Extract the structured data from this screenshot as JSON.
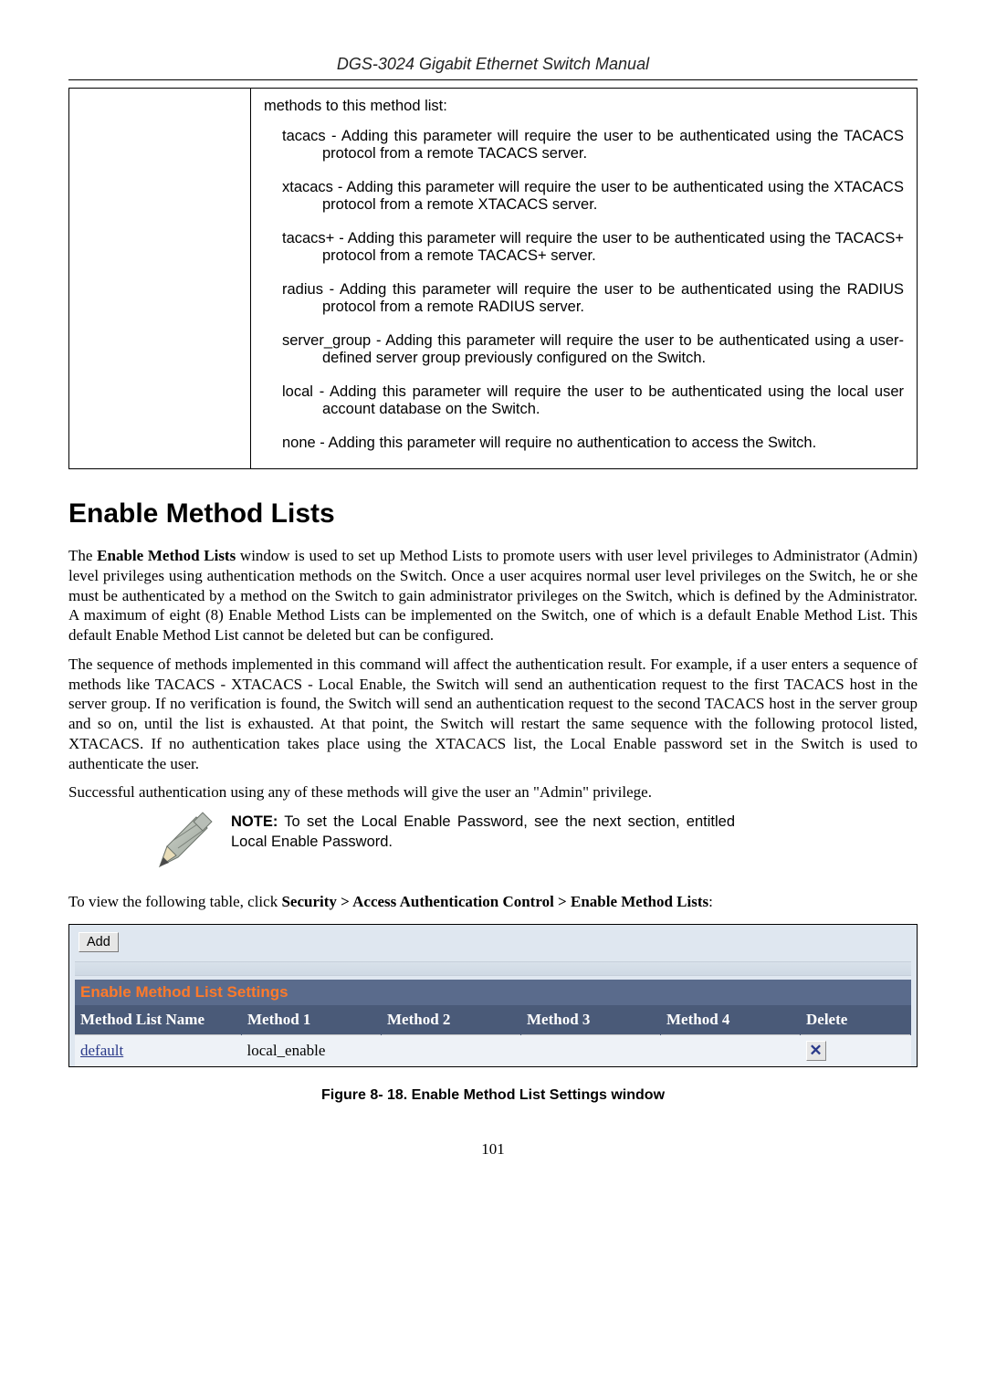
{
  "header": {
    "doc_title": "DGS-3024 Gigabit Ethernet Switch Manual"
  },
  "param_table": {
    "intro": "methods to this method list:",
    "items": [
      {
        "term": "tacacs",
        "dash": " - ",
        "desc_first": "Adding this parameter will require the user to be authenticated using the",
        "desc_rest": "TACACS protocol from a remote TACACS server."
      },
      {
        "term": "xtacacs",
        "dash": " - ",
        "desc_first": "Adding this parameter will require the user to be authenticated using the",
        "desc_rest": "XTACACS protocol from a remote XTACACS server."
      },
      {
        "term": "tacacs+",
        "dash": " - ",
        "desc_first": "Adding this parameter will require the user to be authenticated using the",
        "desc_rest": "TACACS+ protocol from a remote TACACS+ server."
      },
      {
        "term": "radius",
        "dash": " - ",
        "desc_first": "Adding this parameter will require the user to be authenticated using the",
        "desc_rest": "RADIUS protocol from a remote RADIUS server."
      },
      {
        "term": "server_group",
        "dash": " - ",
        "desc_first": "Adding this parameter will require the user to be authenticated",
        "desc_rest": "using a user-defined server group previously configured on the Switch."
      },
      {
        "term": "local",
        "dash": " - ",
        "desc_first": "Adding this parameter will require the user to be authenticated using the",
        "desc_rest": "local user account database on the Switch."
      },
      {
        "term": "none",
        "dash": " - ",
        "desc_first": "Adding this parameter will require no authentication to access the Switch.",
        "desc_rest": ""
      }
    ]
  },
  "section": {
    "heading": "Enable Method Lists",
    "p1_a": "The ",
    "p1_b": "Enable Method Lists",
    "p1_c": " window is used to set up Method Lists to promote users with user level privileges to Administrator (Admin) level privileges using authentication methods on the Switch. Once a user acquires normal user level privileges on the Switch, he or she must be authenticated by a method on the Switch to gain administrator privileges on the Switch, which is defined by the Administrator. A maximum of eight (8) Enable Method Lists can be implemented on the Switch, one of which is a default Enable Method List. This default Enable Method List cannot be deleted but can be configured.",
    "p2": "The sequence of methods implemented in this command will affect the authentication result. For example, if a user enters a sequence of methods like TACACS - XTACACS - Local Enable, the Switch will send an authentication request to the first TACACS host in the server group. If no verification is found, the Switch will send an authentication request to the second TACACS host in the server group and so on, until the list is exhausted. At that point, the Switch will restart the same sequence with the following protocol listed, XTACACS. If no authentication takes place using the XTACACS list, the Local Enable password set in the Switch is used to authenticate the user.",
    "p3": "Successful authentication using any of these methods will give the user an \"Admin\" privilege.",
    "note_label": "NOTE:",
    "note_text": " To set the Local Enable Password, see the next section, entitled Local Enable Password.",
    "nav_a": "To view the following table, click ",
    "nav_b": "Security > Access Authentication Control > Enable Method Lists",
    "nav_c": ":"
  },
  "ui": {
    "add_label": "Add",
    "title": "Enable Method List Settings",
    "cols": {
      "c0": "Method List Name",
      "c1": "Method 1",
      "c2": "Method 2",
      "c3": "Method 3",
      "c4": "Method 4",
      "c5": "Delete"
    },
    "row": {
      "name": "default",
      "m1": "local_enable",
      "m2": "",
      "m3": "",
      "m4": "",
      "del_glyph": "✕"
    }
  },
  "figure": {
    "caption": "Figure 8- 18. Enable Method List Settings window"
  },
  "page_number": "101"
}
